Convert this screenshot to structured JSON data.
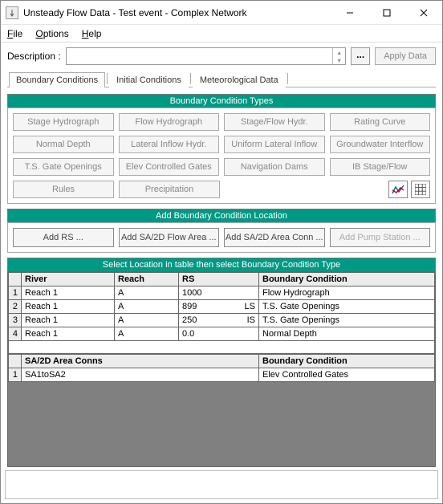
{
  "window": {
    "title": "Unsteady Flow Data - Test event - Complex Network"
  },
  "menu": {
    "file": "File",
    "options": "Options",
    "help": "Help"
  },
  "description": {
    "label": "Description :",
    "value": "",
    "apply": "Apply Data",
    "ellipsis": "..."
  },
  "tabs": {
    "boundary": "Boundary Conditions",
    "initial": "Initial Conditions",
    "meteor": "Meteorological Data"
  },
  "bc_types": {
    "title": "Boundary Condition Types",
    "buttons": [
      [
        "Stage Hydrograph",
        "Flow Hydrograph",
        "Stage/Flow Hydr.",
        "Rating Curve"
      ],
      [
        "Normal Depth",
        "Lateral Inflow Hydr.",
        "Uniform Lateral Inflow",
        "Groundwater Interflow"
      ],
      [
        "T.S. Gate Openings",
        "Elev Controlled Gates",
        "Navigation Dams",
        "IB Stage/Flow"
      ],
      [
        "Rules",
        "Precipitation"
      ]
    ]
  },
  "add_loc": {
    "title": "Add Boundary Condition Location",
    "add_rs": "Add RS ...",
    "add_flow": "Add SA/2D Flow Area ...",
    "add_conn": "Add SA/2D Area Conn ...",
    "add_pump": "Add Pump Station ..."
  },
  "grid": {
    "title": "Select Location in table then select Boundary Condition Type",
    "cols": {
      "river": "River",
      "reach": "Reach",
      "rs": "RS",
      "bc": "Boundary Condition"
    },
    "rows": [
      {
        "n": "1",
        "river": "Reach 1",
        "reach": "A",
        "rs": "1000",
        "rs_suffix": "",
        "bc": "Flow Hydrograph"
      },
      {
        "n": "2",
        "river": "Reach 1",
        "reach": "A",
        "rs": "899",
        "rs_suffix": "LS",
        "bc": "T.S. Gate Openings"
      },
      {
        "n": "3",
        "river": "Reach 1",
        "reach": "A",
        "rs": "250",
        "rs_suffix": "IS",
        "bc": "T.S. Gate Openings"
      },
      {
        "n": "4",
        "river": "Reach 1",
        "reach": "A",
        "rs": "0.0",
        "rs_suffix": "",
        "bc": "Normal Depth"
      }
    ],
    "section2": {
      "header_a": "SA/2D Area Conns",
      "header_b": "Boundary Condition",
      "rows": [
        {
          "n": "1",
          "name": "SA1toSA2",
          "bc": "Elev Controlled Gates"
        }
      ]
    }
  }
}
